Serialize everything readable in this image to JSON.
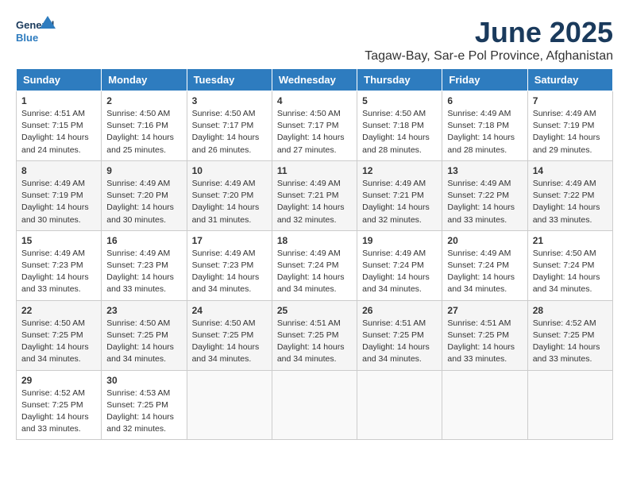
{
  "header": {
    "logo_general": "General",
    "logo_blue": "Blue",
    "month_title": "June 2025",
    "subtitle": "Tagaw-Bay, Sar-e Pol Province, Afghanistan"
  },
  "days_of_week": [
    "Sunday",
    "Monday",
    "Tuesday",
    "Wednesday",
    "Thursday",
    "Friday",
    "Saturday"
  ],
  "weeks": [
    [
      {
        "day": "1",
        "sunrise": "Sunrise: 4:51 AM",
        "sunset": "Sunset: 7:15 PM",
        "daylight": "Daylight: 14 hours and 24 minutes."
      },
      {
        "day": "2",
        "sunrise": "Sunrise: 4:50 AM",
        "sunset": "Sunset: 7:16 PM",
        "daylight": "Daylight: 14 hours and 25 minutes."
      },
      {
        "day": "3",
        "sunrise": "Sunrise: 4:50 AM",
        "sunset": "Sunset: 7:17 PM",
        "daylight": "Daylight: 14 hours and 26 minutes."
      },
      {
        "day": "4",
        "sunrise": "Sunrise: 4:50 AM",
        "sunset": "Sunset: 7:17 PM",
        "daylight": "Daylight: 14 hours and 27 minutes."
      },
      {
        "day": "5",
        "sunrise": "Sunrise: 4:50 AM",
        "sunset": "Sunset: 7:18 PM",
        "daylight": "Daylight: 14 hours and 28 minutes."
      },
      {
        "day": "6",
        "sunrise": "Sunrise: 4:49 AM",
        "sunset": "Sunset: 7:18 PM",
        "daylight": "Daylight: 14 hours and 28 minutes."
      },
      {
        "day": "7",
        "sunrise": "Sunrise: 4:49 AM",
        "sunset": "Sunset: 7:19 PM",
        "daylight": "Daylight: 14 hours and 29 minutes."
      }
    ],
    [
      {
        "day": "8",
        "sunrise": "Sunrise: 4:49 AM",
        "sunset": "Sunset: 7:19 PM",
        "daylight": "Daylight: 14 hours and 30 minutes."
      },
      {
        "day": "9",
        "sunrise": "Sunrise: 4:49 AM",
        "sunset": "Sunset: 7:20 PM",
        "daylight": "Daylight: 14 hours and 30 minutes."
      },
      {
        "day": "10",
        "sunrise": "Sunrise: 4:49 AM",
        "sunset": "Sunset: 7:20 PM",
        "daylight": "Daylight: 14 hours and 31 minutes."
      },
      {
        "day": "11",
        "sunrise": "Sunrise: 4:49 AM",
        "sunset": "Sunset: 7:21 PM",
        "daylight": "Daylight: 14 hours and 32 minutes."
      },
      {
        "day": "12",
        "sunrise": "Sunrise: 4:49 AM",
        "sunset": "Sunset: 7:21 PM",
        "daylight": "Daylight: 14 hours and 32 minutes."
      },
      {
        "day": "13",
        "sunrise": "Sunrise: 4:49 AM",
        "sunset": "Sunset: 7:22 PM",
        "daylight": "Daylight: 14 hours and 33 minutes."
      },
      {
        "day": "14",
        "sunrise": "Sunrise: 4:49 AM",
        "sunset": "Sunset: 7:22 PM",
        "daylight": "Daylight: 14 hours and 33 minutes."
      }
    ],
    [
      {
        "day": "15",
        "sunrise": "Sunrise: 4:49 AM",
        "sunset": "Sunset: 7:23 PM",
        "daylight": "Daylight: 14 hours and 33 minutes."
      },
      {
        "day": "16",
        "sunrise": "Sunrise: 4:49 AM",
        "sunset": "Sunset: 7:23 PM",
        "daylight": "Daylight: 14 hours and 33 minutes."
      },
      {
        "day": "17",
        "sunrise": "Sunrise: 4:49 AM",
        "sunset": "Sunset: 7:23 PM",
        "daylight": "Daylight: 14 hours and 34 minutes."
      },
      {
        "day": "18",
        "sunrise": "Sunrise: 4:49 AM",
        "sunset": "Sunset: 7:24 PM",
        "daylight": "Daylight: 14 hours and 34 minutes."
      },
      {
        "day": "19",
        "sunrise": "Sunrise: 4:49 AM",
        "sunset": "Sunset: 7:24 PM",
        "daylight": "Daylight: 14 hours and 34 minutes."
      },
      {
        "day": "20",
        "sunrise": "Sunrise: 4:49 AM",
        "sunset": "Sunset: 7:24 PM",
        "daylight": "Daylight: 14 hours and 34 minutes."
      },
      {
        "day": "21",
        "sunrise": "Sunrise: 4:50 AM",
        "sunset": "Sunset: 7:24 PM",
        "daylight": "Daylight: 14 hours and 34 minutes."
      }
    ],
    [
      {
        "day": "22",
        "sunrise": "Sunrise: 4:50 AM",
        "sunset": "Sunset: 7:25 PM",
        "daylight": "Daylight: 14 hours and 34 minutes."
      },
      {
        "day": "23",
        "sunrise": "Sunrise: 4:50 AM",
        "sunset": "Sunset: 7:25 PM",
        "daylight": "Daylight: 14 hours and 34 minutes."
      },
      {
        "day": "24",
        "sunrise": "Sunrise: 4:50 AM",
        "sunset": "Sunset: 7:25 PM",
        "daylight": "Daylight: 14 hours and 34 minutes."
      },
      {
        "day": "25",
        "sunrise": "Sunrise: 4:51 AM",
        "sunset": "Sunset: 7:25 PM",
        "daylight": "Daylight: 14 hours and 34 minutes."
      },
      {
        "day": "26",
        "sunrise": "Sunrise: 4:51 AM",
        "sunset": "Sunset: 7:25 PM",
        "daylight": "Daylight: 14 hours and 34 minutes."
      },
      {
        "day": "27",
        "sunrise": "Sunrise: 4:51 AM",
        "sunset": "Sunset: 7:25 PM",
        "daylight": "Daylight: 14 hours and 33 minutes."
      },
      {
        "day": "28",
        "sunrise": "Sunrise: 4:52 AM",
        "sunset": "Sunset: 7:25 PM",
        "daylight": "Daylight: 14 hours and 33 minutes."
      }
    ],
    [
      {
        "day": "29",
        "sunrise": "Sunrise: 4:52 AM",
        "sunset": "Sunset: 7:25 PM",
        "daylight": "Daylight: 14 hours and 33 minutes."
      },
      {
        "day": "30",
        "sunrise": "Sunrise: 4:53 AM",
        "sunset": "Sunset: 7:25 PM",
        "daylight": "Daylight: 14 hours and 32 minutes."
      },
      null,
      null,
      null,
      null,
      null
    ]
  ]
}
